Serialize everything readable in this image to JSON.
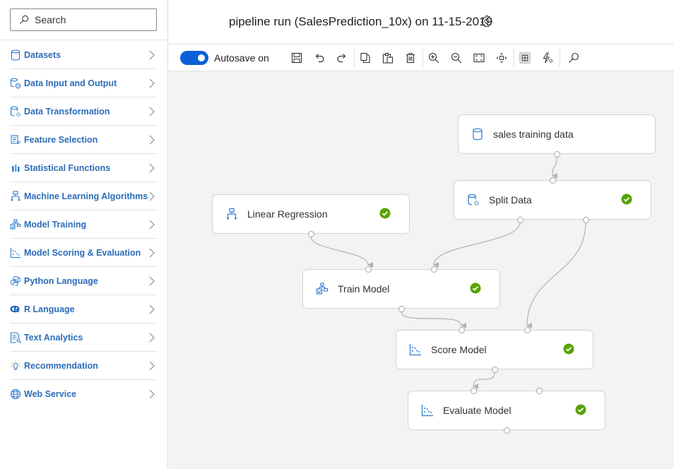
{
  "sidebar": {
    "search": {
      "placeholder": "Search",
      "value": ""
    },
    "items": [
      {
        "label": "Datasets",
        "icon": "database-icon"
      },
      {
        "label": "Data Input and Output",
        "icon": "data-io-icon"
      },
      {
        "label": "Data Transformation",
        "icon": "data-transform-icon"
      },
      {
        "label": "Feature Selection",
        "icon": "feature-selection-icon"
      },
      {
        "label": "Statistical Functions",
        "icon": "statistics-icon"
      },
      {
        "label": "Machine Learning Algorithms",
        "icon": "algorithm-icon"
      },
      {
        "label": "Model Training",
        "icon": "model-training-icon"
      },
      {
        "label": "Model Scoring & Evaluation",
        "icon": "scatter-icon"
      },
      {
        "label": "Python Language",
        "icon": "python-icon"
      },
      {
        "label": "R Language",
        "icon": "r-language-icon"
      },
      {
        "label": "Text Analytics",
        "icon": "text-analytics-icon"
      },
      {
        "label": "Recommendation",
        "icon": "lightbulb-icon"
      },
      {
        "label": "Web Service",
        "icon": "globe-icon"
      }
    ]
  },
  "header": {
    "title": "pipeline run (SalesPrediction_10x) on 11-15-2019",
    "settings_icon": "gear-icon"
  },
  "toolbar": {
    "autosave_label": "Autosave on",
    "autosave_on": true,
    "buttons": [
      "save",
      "undo",
      "redo",
      "copy",
      "paste",
      "delete",
      "zoom-in",
      "zoom-out",
      "fit-to-screen",
      "pan",
      "grid",
      "auto-layout",
      "search"
    ]
  },
  "canvas": {
    "nodes": [
      {
        "id": "sales",
        "label": "sales training data",
        "icon": "database-icon",
        "status": ""
      },
      {
        "id": "split",
        "label": "Split Data",
        "icon": "data-transform-icon",
        "status": "completed"
      },
      {
        "id": "linreg",
        "label": "Linear Regression",
        "icon": "algorithm-icon",
        "status": "completed"
      },
      {
        "id": "train",
        "label": "Train Model",
        "icon": "model-training-icon",
        "status": "completed"
      },
      {
        "id": "score",
        "label": "Score Model",
        "icon": "scatter-icon",
        "status": "completed"
      },
      {
        "id": "evaluate",
        "label": "Evaluate Model",
        "icon": "scatter-icon",
        "status": "completed"
      }
    ],
    "edges": [
      {
        "from": "sales",
        "to": "split"
      },
      {
        "from": "linreg",
        "to": "train"
      },
      {
        "from": "split",
        "to": "train"
      },
      {
        "from": "split",
        "to": "score"
      },
      {
        "from": "train",
        "to": "score"
      },
      {
        "from": "score",
        "to": "evaluate"
      }
    ]
  },
  "colors": {
    "accent": "#0a60d6",
    "nav_text": "#2b6cb8",
    "success": "#57a300",
    "edge": "#a9b4c2"
  }
}
